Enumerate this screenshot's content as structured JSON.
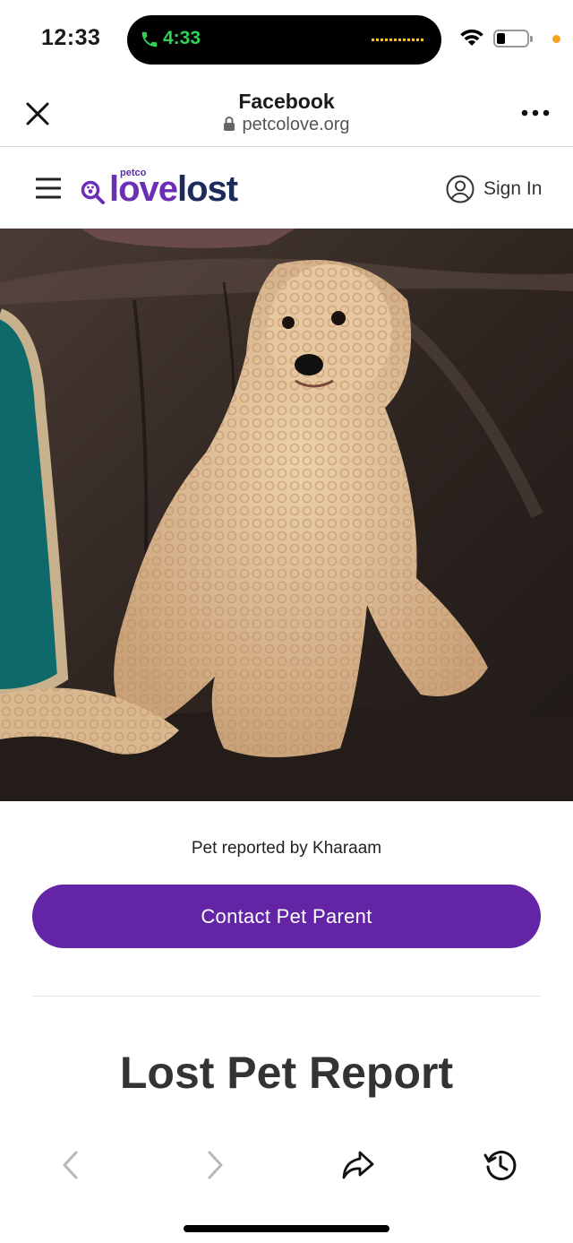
{
  "status_bar": {
    "time": "12:33",
    "call_time": "4:33",
    "icons": [
      "phone-icon",
      "wifi-icon",
      "battery-icon"
    ],
    "call_color": "#31d158",
    "privacy_dot_color": "#f7a21b"
  },
  "browser": {
    "title": "Facebook",
    "url": "petcolove.org",
    "icons": [
      "close-icon",
      "lock-icon",
      "more-icon"
    ]
  },
  "site_nav": {
    "logo": {
      "brand_small": "petco",
      "brand_love": "love",
      "brand_lost": "lost"
    },
    "sign_in_label": "Sign In",
    "icons": [
      "hamburger-icon",
      "magnifier-paw-icon",
      "user-circle-icon"
    ]
  },
  "main": {
    "photo_description_icon": "dog-photo",
    "reported_by": "Pet reported by Kharaam",
    "contact_button_label": "Contact Pet Parent",
    "section_title": "Lost Pet Report"
  },
  "toolbar": {
    "icons": [
      "back-arrow-icon",
      "forward-arrow-icon",
      "share-arrow-icon",
      "history-icon"
    ]
  },
  "colors": {
    "brand_purple": "#6325a5",
    "brand_navy": "#1d2a5c"
  }
}
